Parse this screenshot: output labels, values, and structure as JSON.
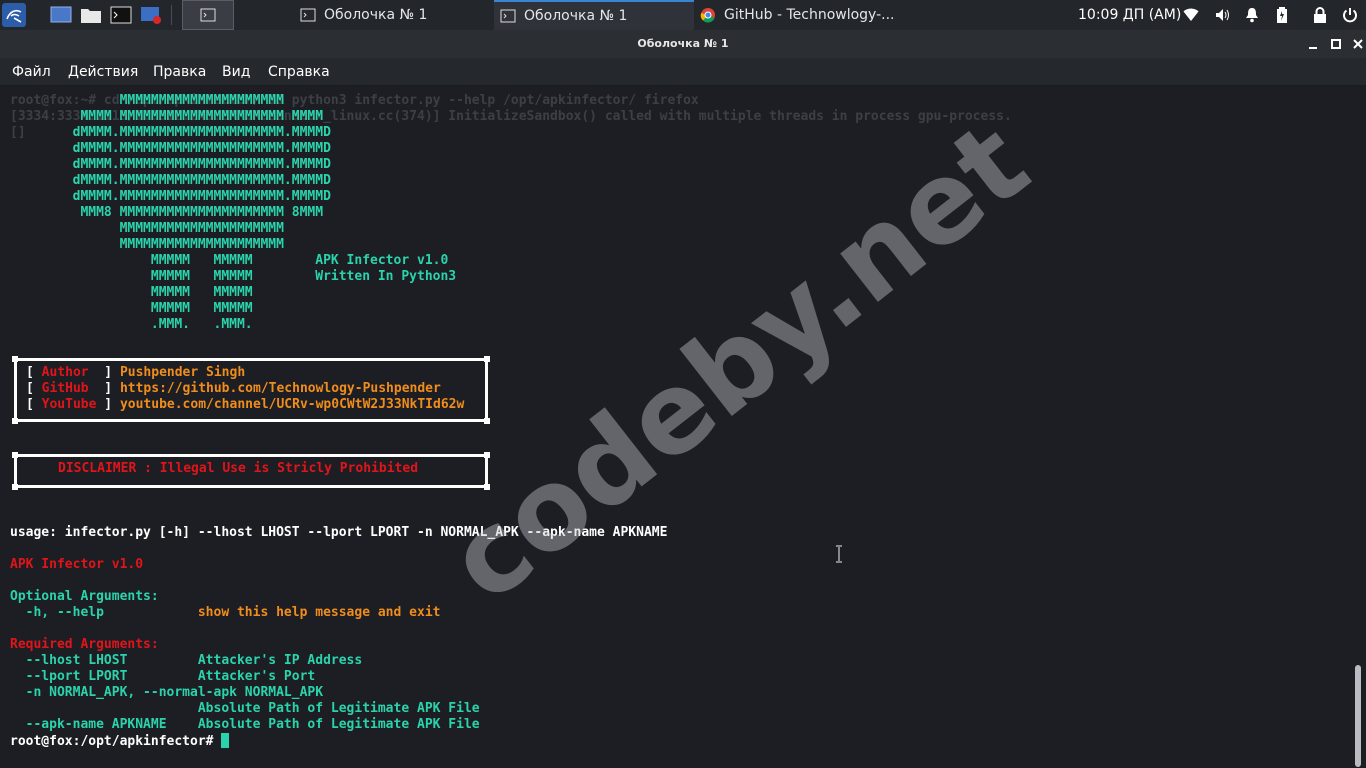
{
  "taskbar": {
    "tasks": [
      {
        "label": "Оболочка № 1",
        "icon": "terminal-icon"
      },
      {
        "label": "Оболочка № 1",
        "icon": "terminal-icon"
      },
      {
        "label": "GitHub - Technowlogy-...",
        "icon": "chrome-icon"
      }
    ],
    "clock": "10:09 ДП (AM)"
  },
  "window": {
    "title": "Оболочка № 1"
  },
  "menu": [
    "Файл",
    "Действия",
    "Правка",
    "Вид",
    "Справка"
  ],
  "terminal": {
    "bg_lines": [
      "root@fox:~# cd /opt/apkinfector/ && python3 infector.py --help /opt/apkinfector/ firefox",
      "[3334:3334:1115/100912.245:ERROR:sandbox_linux.cc(374)] InitializeSandbox() called with multiple threads in process gpu-process.",
      "[]"
    ],
    "banner_art": [
      "              MMMMMMMMMMMMMMMMMMMMM",
      "         MMMM MMMMMMMMMMMMMMMMMMMMM MMMM",
      "        dMMMM.MMMMMMMMMMMMMMMMMMMMM.MMMMD",
      "        dMMMM.MMMMMMMMMMMMMMMMMMMMM.MMMMD",
      "        dMMMM.MMMMMMMMMMMMMMMMMMMMM.MMMMD",
      "        dMMMM.MMMMMMMMMMMMMMMMMMMMM.MMMMD",
      "        dMMMM.MMMMMMMMMMMMMMMMMMMMM.MMMMD",
      "         MMM8 MMMMMMMMMMMMMMMMMMMMM 8MMM",
      "              MMMMMMMMMMMMMMMMMMMMM",
      "              MMMMMMMMMMMMMMMMMMMMM",
      "                  MMMMM   MMMMM        APK Infector v1.0",
      "                  MMMMM   MMMMM        Written In Python3",
      "                  MMMMM   MMMMM",
      "                  MMMMM   MMMMM",
      "                  .MMM.   .MMM."
    ],
    "info_rows": [
      {
        "key": "Author ",
        "value": "Pushpender Singh"
      },
      {
        "key": "GitHub ",
        "value": "https://github.com/Technowlogy-Pushpender"
      },
      {
        "key": "YouTube",
        "value": "youtube.com/channel/UCRv-wp0CWtW2J33NkTId62w"
      }
    ],
    "disclaimer": "DISCLAIMER : Illegal Use is Stricly Prohibited",
    "usage": "usage: infector.py [-h] --lhost LHOST --lport LPORT -n NORMAL_APK --apk-name APKNAME",
    "app_title": "APK Infector v1.0",
    "optional_heading": "Optional Arguments:",
    "optional_args": [
      {
        "flag": "  -h, --help            ",
        "desc": "show this help message and exit"
      }
    ],
    "required_heading": "Required Arguments:",
    "required_args": [
      {
        "flag": "  --lhost LHOST         ",
        "desc": "Attacker's IP Address"
      },
      {
        "flag": "  --lport LPORT         ",
        "desc": "Attacker's Port"
      },
      {
        "flag": "  -n NORMAL_APK, --normal-apk NORMAL_APK",
        "desc": ""
      },
      {
        "flag": "                        ",
        "desc": "Absolute Path of Legitimate APK File"
      },
      {
        "flag": "  --apk-name APKNAME    ",
        "desc": "Absolute Path of Legitimate APK File"
      }
    ],
    "prompt": "root@fox:/opt/apkinfector#"
  },
  "watermark": "codeby.net",
  "colors": {
    "terminal_bg": "#1c1e23",
    "green": "#2bd3ac",
    "red": "#e0151b",
    "orange": "#f08d1c"
  }
}
